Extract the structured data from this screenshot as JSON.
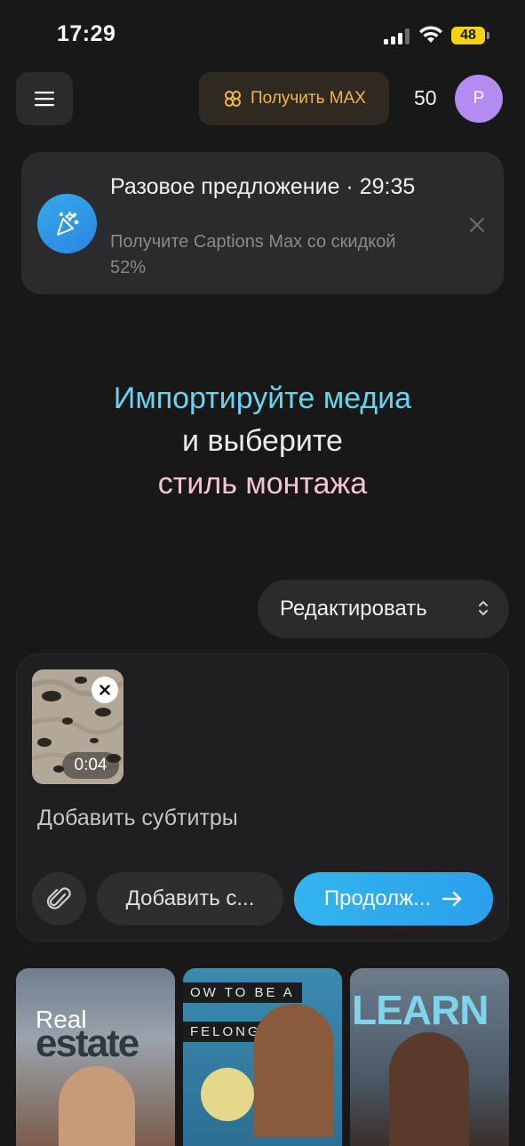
{
  "status_bar": {
    "time": "17:29",
    "battery": "48"
  },
  "header": {
    "get_max_label": "Получить MAX",
    "credits": "50",
    "avatar_initial": "P"
  },
  "offer": {
    "title": "Разовое предложение · 29:35",
    "subtitle": "Получите Captions Max со скидкой 52%"
  },
  "hero": {
    "line1": "Импортируйте медиа",
    "line2": "и выберите",
    "line3": "стиль монтажа"
  },
  "mode_select": {
    "value": "Редактировать"
  },
  "composer": {
    "clip_duration": "0:04",
    "prompt": "Добавить субтитры",
    "add_style_label": "Добавить с...",
    "continue_label": "Продолж..."
  },
  "templates": [
    {
      "label_top": "Real",
      "label_bottom": "estate"
    },
    {
      "label_top": "OW TO BE A",
      "label_bottom": "FELONG"
    },
    {
      "label_top": "LEARN",
      "label_bottom": ""
    }
  ],
  "colors": {
    "accent": "#33b4ef",
    "gold": "#f2b445",
    "avatar": "#b48bf0"
  }
}
